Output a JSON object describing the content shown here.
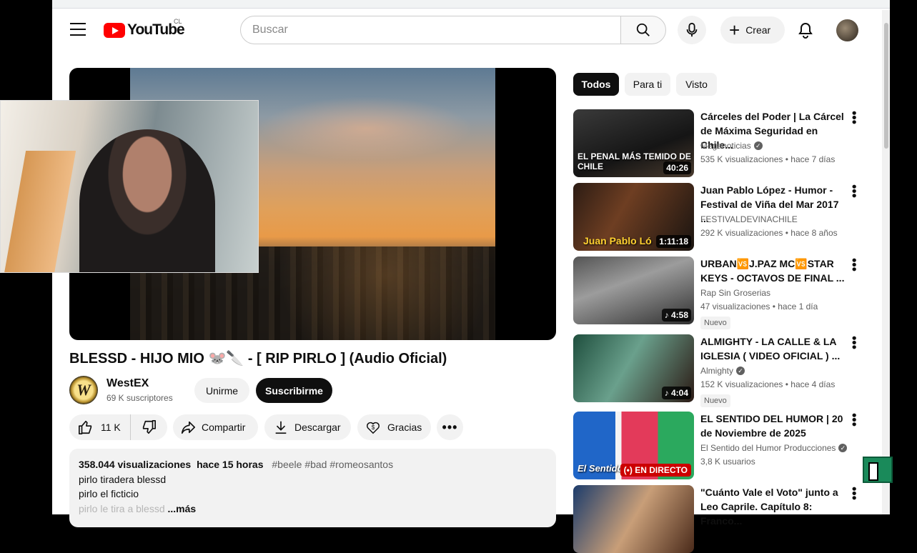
{
  "header": {
    "logo_text": "YouTube",
    "country_code": "CL",
    "search_placeholder": "Buscar",
    "create_label": "Crear"
  },
  "video": {
    "title": "BLESSD - HIJO MIO 🐭🔪 - [ RIP PIRLO ] (Audio Oficial)",
    "channel_name": "WestEX",
    "channel_initial": "W",
    "subscribers": "69 K suscriptores",
    "join_label": "Unirme",
    "subscribe_label": "Suscribirme",
    "likes": "11 K",
    "share_label": "Compartir",
    "download_label": "Descargar",
    "thanks_label": "Gracias",
    "more_label": "•••"
  },
  "description": {
    "views": "358.044 visualizaciones",
    "posted": "hace 15 horas",
    "tags": "#beele #bad #romeosantos",
    "lines": [
      "pirlo tiradera blessd",
      "pirlo el ficticio"
    ],
    "last_line": "pirlo le tira a blessd",
    "more_link": "...más"
  },
  "chips": [
    "Todos",
    "Para ti",
    "Visto"
  ],
  "recommendations": [
    {
      "title": "Cárceles del Poder | La Cárcel de Máxima Seguridad en Chile...",
      "channel": "Meganoticias",
      "verified": true,
      "stats": "535 K visualizaciones • hace 7 días",
      "duration": "40:26",
      "thumb_caption": "EL PENAL MÁS TEMIDO DE CHILE",
      "badge": ""
    },
    {
      "title": "Juan Pablo López - Humor - Festival de Viña del Mar 2017 ...",
      "channel": "FESTIVALDEVINACHILE",
      "verified": false,
      "stats": "292 K visualizaciones • hace 8 años",
      "duration": "1:11:18",
      "thumb_caption": "Juan Pablo Ló",
      "badge": ""
    },
    {
      "title": "URBAN🆚J.PAZ MC🆚STAR KEYS - OCTAVOS DE FINAL ...",
      "channel": "Rap Sin Groserias",
      "verified": false,
      "stats": "47 visualizaciones • hace 1 día",
      "duration": "♪ 4:58",
      "thumb_caption": "",
      "badge": "Nuevo"
    },
    {
      "title": "ALMIGHTY - LA CALLE & LA IGLESIA ( VIDEO OFICIAL ) ...",
      "channel": "Almighty",
      "verified": true,
      "stats": "152 K visualizaciones • hace 4 días",
      "duration": "♪ 4:04",
      "thumb_caption": "",
      "badge": "Nuevo"
    },
    {
      "title": "EL SENTIDO DEL HUMOR | 20 de Noviembre de 2025",
      "channel": "El Sentido del Humor Producciones",
      "verified": true,
      "stats": "3,8 K usuarios",
      "duration": "(•) EN DIRECTO",
      "thumb_caption": "El Sentido del HUMOR",
      "badge": ""
    },
    {
      "title": "\"Cuánto Vale el Voto\" junto a Leo Caprile. Capítulo 8: Franco...",
      "channel": "",
      "verified": false,
      "stats": "",
      "duration": "",
      "thumb_caption": "",
      "badge": ""
    }
  ],
  "icons": [
    "menu-icon",
    "search-icon",
    "mic-icon",
    "plus-icon",
    "bell-icon",
    "like-icon",
    "dislike-icon",
    "share-icon",
    "download-icon",
    "thanks-icon",
    "more-vert-icon"
  ],
  "colors": {
    "brand_red": "#ff0000",
    "subscribe_bg": "#0f0f0f",
    "chip_active": "#0f0f0f"
  }
}
